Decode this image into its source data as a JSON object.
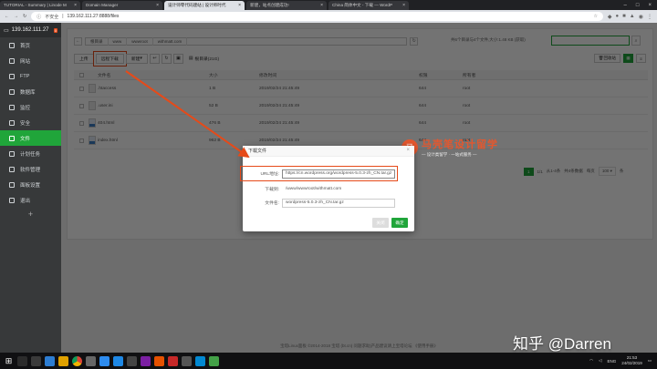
{
  "browser": {
    "tabs": [
      {
        "title": "TUTORIAL - Summary | Linode M"
      },
      {
        "title": "Domain Manager"
      },
      {
        "title": "设计师零代码建站 | 设计师时代"
      },
      {
        "title": "新建，站点创建成功!"
      },
      {
        "title": "China 简体中文 - 下载 — WordP"
      }
    ],
    "active_tab": 2,
    "insecure_label": "不安全",
    "url": "139.162.111.27:8888/files"
  },
  "sidebar": {
    "server": "139.162.111.27",
    "badge": "0",
    "items": [
      {
        "label": "首页",
        "icon": "home-icon"
      },
      {
        "label": "网站",
        "icon": "globe-icon"
      },
      {
        "label": "FTP",
        "icon": "ftp-icon"
      },
      {
        "label": "数据库",
        "icon": "database-icon"
      },
      {
        "label": "监控",
        "icon": "monitor-icon"
      },
      {
        "label": "安全",
        "icon": "shield-icon"
      },
      {
        "label": "文件",
        "icon": "folder-icon",
        "active": true
      },
      {
        "label": "计划任务",
        "icon": "clock-icon"
      },
      {
        "label": "软件管理",
        "icon": "app-icon"
      },
      {
        "label": "面板设置",
        "icon": "settings-icon"
      },
      {
        "label": "退出",
        "icon": "logout-icon"
      }
    ],
    "add": "+"
  },
  "files": {
    "breadcrumbs": [
      "根目录",
      "www",
      "wwwroot",
      "withmatt.com"
    ],
    "disk_info": "共6个目录与4个文件,大小:1.48 KB (获取)",
    "toolbar": {
      "upload": "上传",
      "remote_download": "远程下载",
      "new": "新建",
      "root_dir": "根目录(21G)"
    },
    "right_buttons": {
      "recycle": "回收站"
    },
    "columns": [
      "文件名",
      "大小",
      "修改时间",
      "权限",
      "所有者"
    ],
    "rows": [
      {
        "name": ".htaccess",
        "size": "1 B",
        "date": "2019/02/24 21:45:49",
        "perm": "644",
        "owner": "root",
        "type": "file"
      },
      {
        "name": ".user.ini",
        "size": "52 B",
        "date": "2019/02/24 21:45:49",
        "perm": "644",
        "owner": "root",
        "type": "file"
      },
      {
        "name": "404.html",
        "size": "476 B",
        "date": "2019/02/24 21:45:49",
        "perm": "644",
        "owner": "root",
        "type": "html"
      },
      {
        "name": "index.html",
        "size": "962 B",
        "date": "2019/02/24 21:45:49",
        "perm": "644",
        "owner": "root",
        "type": "html"
      }
    ],
    "pagination": {
      "current": "1",
      "range": "1/1",
      "from_to": "从1-4条",
      "total": "共4条数据",
      "per_page_label": "每页",
      "per_page": "100",
      "unit": "条"
    }
  },
  "copyright": "宝塔Linux面板 ©2014-2018 宝塔 (bt.cn)    问题求助|产品建议请上宝塔论坛    《使用手册》",
  "dialog": {
    "title": "下载文件",
    "close": "×",
    "url_label": "URL地址:",
    "url_value": "https://cn.wordpress.org/wordpress-5.0.3-zh_CN.tar.gz",
    "dir_label": "下载到:",
    "dir_value": "/www/wwwroot/withmatt.com",
    "name_label": "文件名:",
    "name_value": "wordpress-5.0.3-zh_CN.tar.gz",
    "cancel": "关闭",
    "confirm": "确定"
  },
  "watermark": {
    "title": "马壳笔设计留学",
    "subtitle": "— 设计类留学 · 一站式服务 —",
    "mark": "马",
    "zhihu": "知乎 @Darren"
  },
  "taskbar": {
    "lang": "ENG",
    "time": "21:53",
    "date": "24/02/2019"
  },
  "colors": {
    "accent": "#20a53a",
    "highlight": "#e64a19"
  }
}
